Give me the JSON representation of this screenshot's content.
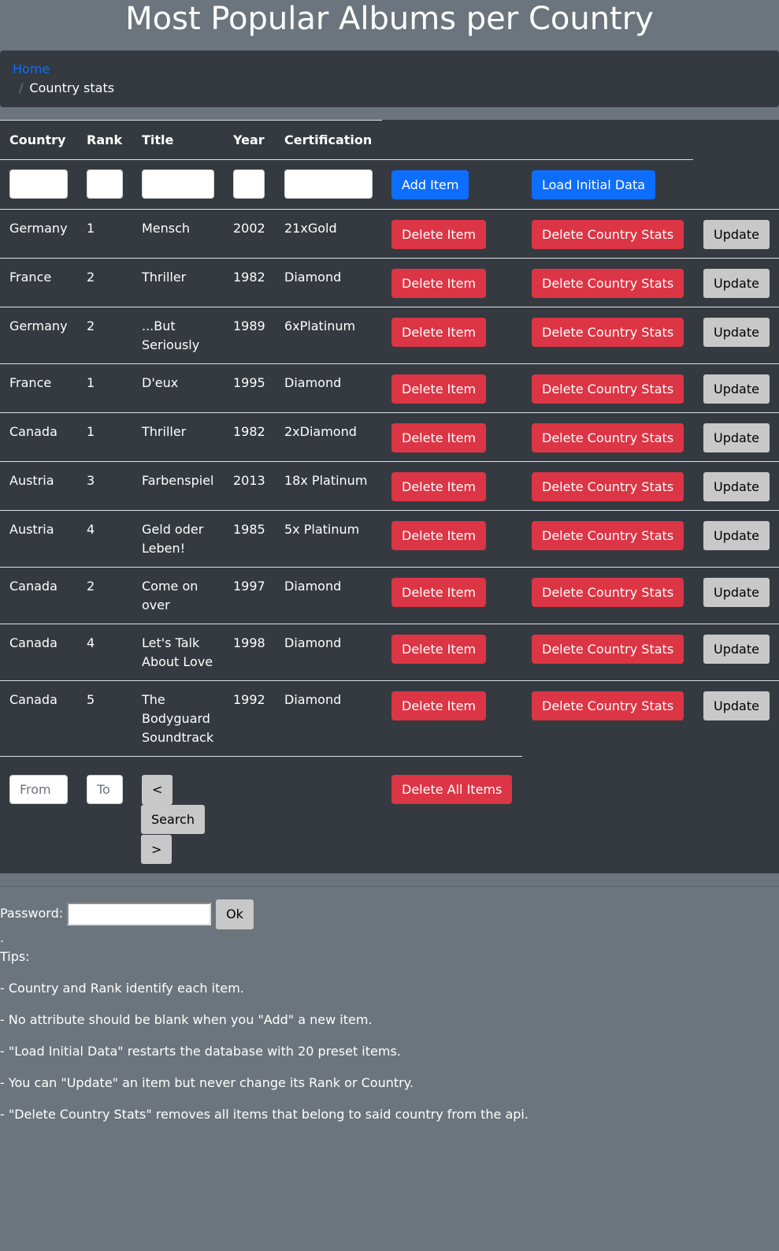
{
  "title": "Most Popular Albums per Country",
  "breadcrumb": {
    "home": "Home",
    "separator": "/",
    "current": "Country stats"
  },
  "table": {
    "headers": {
      "country": "Country",
      "rank": "Rank",
      "title": "Title",
      "year": "Year",
      "certification": "Certification"
    },
    "add_button": "Add Item",
    "load_button": "Load Initial Data",
    "row_buttons": {
      "delete": "Delete Item",
      "delete_country": "Delete Country Stats",
      "update": "Update"
    },
    "rows": [
      {
        "country": "Germany",
        "rank": "1",
        "title": [
          "Mensch"
        ],
        "year": "2002",
        "certification": "21xGold"
      },
      {
        "country": "France",
        "rank": "2",
        "title": [
          "Thriller"
        ],
        "year": "1982",
        "certification": "Diamond"
      },
      {
        "country": "Germany",
        "rank": "2",
        "title": [
          "...But",
          "Seriously"
        ],
        "year": "1989",
        "certification": "6xPlatinum"
      },
      {
        "country": "France",
        "rank": "1",
        "title": [
          "D'eux"
        ],
        "year": "1995",
        "certification": "Diamond"
      },
      {
        "country": "Canada",
        "rank": "1",
        "title": [
          "Thriller"
        ],
        "year": "1982",
        "certification": "2xDiamond"
      },
      {
        "country": "Austria",
        "rank": "3",
        "title": [
          "Farbenspiel"
        ],
        "year": "2013",
        "certification": "18x Platinum"
      },
      {
        "country": "Austria",
        "rank": "4",
        "title": [
          "Geld oder",
          "Leben!"
        ],
        "year": "1985",
        "certification": "5x Platinum"
      },
      {
        "country": "Canada",
        "rank": "2",
        "title": [
          "Come on",
          "over"
        ],
        "year": "1997",
        "certification": "Diamond"
      },
      {
        "country": "Canada",
        "rank": "4",
        "title": [
          "Let's Talk",
          "About Love"
        ],
        "year": "1998",
        "certification": "Diamond"
      },
      {
        "country": "Canada",
        "rank": "5",
        "title": [
          "The",
          "Bodyguard",
          "Soundtrack"
        ],
        "year": "1992",
        "certification": "Diamond"
      }
    ],
    "footer": {
      "from_placeholder": "From",
      "to_placeholder": "To",
      "prev_label": "<",
      "search_label": "Search",
      "next_label": ">",
      "delete_all_label": "Delete All Items"
    }
  },
  "password": {
    "label": "Password:",
    "ok_label": "Ok",
    "dot": "."
  },
  "tips": {
    "heading": "Tips:",
    "items": [
      "- Country and Rank identify each item.",
      "- No attribute should be blank when you \"Add\" a new item.",
      "- \"Load Initial Data\" restarts the database with 20 preset items.",
      "- You can \"Update\" an item but never change its Rank or Country.",
      "- \"Delete Country Stats\" removes all items that belong to said country from the api."
    ]
  },
  "colors": {
    "page_bg": "#6c757d",
    "table_bg": "#343a40",
    "danger": "#dc3545",
    "primary": "#0d6efd",
    "light_button": "#c8c8c8",
    "link": "#0d6efd"
  }
}
